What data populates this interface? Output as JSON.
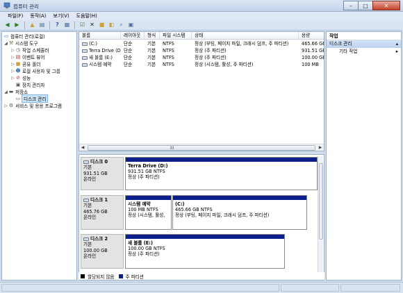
{
  "window": {
    "title": "컴퓨터 관리"
  },
  "menu": [
    "파일(F)",
    "동작(A)",
    "보기(V)",
    "도움말(H)"
  ],
  "toolbar_icons": [
    "back-icon",
    "forward-icon",
    "up-folder-icon",
    "show-hide-tree-icon",
    "help-icon",
    "console-icon",
    "properties-icon",
    "delete-icon",
    "folder-icon",
    "open-folder-icon",
    "search-icon",
    "magnify-icon"
  ],
  "tree": [
    {
      "label": "컴퓨터 관리(로컬)",
      "icon": "computer-icon",
      "depth": 0,
      "exp": ""
    },
    {
      "label": "시스템 도구",
      "icon": "tools-icon",
      "depth": 1,
      "exp": "◢"
    },
    {
      "label": "작업 스케줄러",
      "icon": "clock-icon",
      "depth": 2,
      "exp": "▷"
    },
    {
      "label": "이벤트 뷰어",
      "icon": "event-icon",
      "depth": 2,
      "exp": "▷"
    },
    {
      "label": "공유 폴더",
      "icon": "folder-icon",
      "depth": 2,
      "exp": "▷"
    },
    {
      "label": "로컬 사용자 및 그룹",
      "icon": "users-icon",
      "depth": 2,
      "exp": "▷"
    },
    {
      "label": "성능",
      "icon": "performance-icon",
      "depth": 2,
      "exp": "▷"
    },
    {
      "label": "장치 관리자",
      "icon": "device-icon",
      "depth": 2,
      "exp": ""
    },
    {
      "label": "저장소",
      "icon": "storage-icon",
      "depth": 1,
      "exp": "◢"
    },
    {
      "label": "디스크 관리",
      "icon": "disk-icon",
      "depth": 2,
      "exp": "",
      "selected": true
    },
    {
      "label": "서비스 및 응용 프로그램",
      "icon": "services-icon",
      "depth": 1,
      "exp": "▷"
    }
  ],
  "volume_table": {
    "headers": [
      "볼륨",
      "레이아웃",
      "형식",
      "파일 시스템",
      "상태",
      "용량"
    ],
    "rows": [
      [
        "(C:)",
        "단순",
        "기본",
        "NTFS",
        "정상 (부팅, 페이지 파일, 크래시 덤프, 주 파티션)",
        "465.66 GB"
      ],
      [
        "Terra Drive (D:)",
        "단순",
        "기본",
        "NTFS",
        "정상 (주 파티션)",
        "931.51 GB"
      ],
      [
        "새 볼륨 (E:)",
        "단순",
        "기본",
        "NTFS",
        "정상 (주 파티션)",
        "100.00 GB"
      ],
      [
        "시스템 예약",
        "단순",
        "기본",
        "NTFS",
        "정상 (시스템, 활성, 주 파티션)",
        "100 MB"
      ]
    ],
    "scroll_grip": "III"
  },
  "disks": [
    {
      "name": "디스크 0",
      "type": "기본",
      "size": "931.51 GB",
      "status": "온라인",
      "partitions": [
        {
          "name": "Terra Drive  (D:)",
          "size": "931.51 GB NTFS",
          "status": "정상 (주 파티션)"
        }
      ]
    },
    {
      "name": "디스크 1",
      "type": "기본",
      "size": "465.76 GB",
      "status": "온라인",
      "partitions": [
        {
          "name": "시스템 예약",
          "size": "100 MB NTFS",
          "status": "정상 (시스템, 활성,"
        },
        {
          "name": "(C:)",
          "size": "465.66 GB NTFS",
          "status": "정상 (부팅, 페이지 파일, 크래시 덤프, 주 파티션)"
        }
      ]
    },
    {
      "name": "디스크 2",
      "type": "기본",
      "size": "100.00 GB",
      "status": "온라인",
      "partitions": [
        {
          "name": "새 볼륨  (E:)",
          "size": "100.00 GB NTFS",
          "status": "정상 (주 파티션)"
        }
      ]
    }
  ],
  "legend": [
    {
      "label": "할당되지 않음",
      "color": "#000000"
    },
    {
      "label": "주 파티션",
      "color": "#0b1f8c"
    }
  ],
  "actions": {
    "title": "작업",
    "section": "디스크 관리",
    "items": [
      "기타 작업"
    ]
  },
  "colors": {
    "partition_bar": "#0b1f8c",
    "selection": "#cde4f7"
  }
}
